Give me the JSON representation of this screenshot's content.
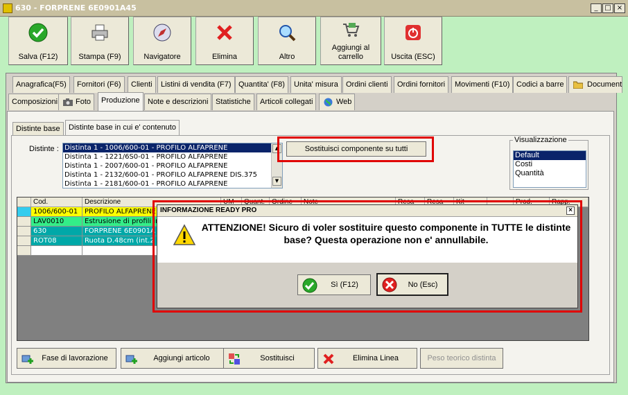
{
  "window": {
    "title": "630 - FORPRENE 6E0901A45",
    "controls": [
      "_",
      "□",
      "×"
    ]
  },
  "toolbar": [
    {
      "id": "salva",
      "label": "Salva (F12)",
      "icon": "check-icon"
    },
    {
      "id": "stampa",
      "label": "Stampa (F9)",
      "icon": "printer-icon"
    },
    {
      "id": "navigatore",
      "label": "Navigatore",
      "icon": "compass-icon"
    },
    {
      "id": "elimina",
      "label": "Elimina",
      "icon": "x-icon"
    },
    {
      "id": "altro",
      "label": "Altro",
      "icon": "search-icon"
    },
    {
      "id": "carrello",
      "label": "Aggiungi al carrello",
      "icon": "cart-icon"
    },
    {
      "id": "uscita",
      "label": "Uscita (ESC)",
      "icon": "power-icon"
    }
  ],
  "tabs_row1": [
    "Anagrafica(F5)",
    "Fornitori (F6)",
    "Clienti",
    "Listini di vendita (F7)",
    "Quantita' (F8)",
    "Unita' misura",
    "Ordini clienti",
    "Ordini fornitori",
    "Movimenti (F10)",
    "Codici a barre",
    "Document"
  ],
  "tabs_row2": [
    "Composizioni",
    "Foto",
    "Produzione",
    "Note e descrizioni",
    "Statistiche",
    "Articoli collegati",
    "Web"
  ],
  "subtabs": [
    "Distinte base",
    "Distinte base in cui e' contenuto"
  ],
  "distinte": {
    "label": "Distinte :",
    "items": [
      "Distinta 1 - 1006/600-01 - PROFILO ALFAPRENE",
      "Distinta 1 - 1221/6S0-01 - PROFILO ALFAPRENE",
      "Distinta 1 - 2007/600-01 - PROFILO ALFAPRENE",
      "Distinta 1 - 2132/600-01 - PROFILO ALFAPRENE DIS.375",
      "Distinta 1 - 2181/600-01 - PROFILO ALFAPRENE"
    ],
    "selected": 0
  },
  "sostituisci_button": "Sostituisci componente su tutti",
  "visualizzazione": {
    "legend": "Visualizzazione",
    "options": [
      "Default",
      "Costi",
      "Quantità"
    ],
    "selected": 0
  },
  "grid": {
    "headers": [
      "Cod.",
      "Descrizione",
      "UM",
      "Quant.",
      "Ordine",
      "Note",
      "Resa",
      "Resa",
      "Kit",
      "",
      "Prod.",
      "Rapp."
    ],
    "rows": [
      {
        "code": "1006/600-01",
        "desc": "PROFILO ALFAPRENE",
        "color": "#ffff00"
      },
      {
        "code": "LAV0010",
        "desc": "Estrusione di profili in",
        "color": "#33ee88"
      },
      {
        "code": "630",
        "desc": "FORPRENE 6E0901A",
        "color": "#00a8a8"
      },
      {
        "code": "ROT08",
        "desc": "Ruota D.48cm (int.2",
        "color": "#00a8a8"
      }
    ]
  },
  "bottom_buttons": [
    {
      "label": "Fase di lavorazione",
      "icon": "add-icon"
    },
    {
      "label": "Aggiungi articolo",
      "icon": "add-icon"
    },
    {
      "label": "Sostituisci",
      "icon": "swap-icon"
    },
    {
      "label": "Elimina Linea",
      "icon": "x-icon"
    },
    {
      "label": "Peso teorico distinta",
      "icon": ""
    }
  ],
  "dialog": {
    "title": "INFORMAZIONE READY PRO",
    "close": "×",
    "message": "ATTENZIONE! Sicuro di voler sostituire questo componente in TUTTE le distinte base? Questa operazione non e' annullabile.",
    "yes_label": "Sì (F12)",
    "no_label": "No (Esc)"
  }
}
